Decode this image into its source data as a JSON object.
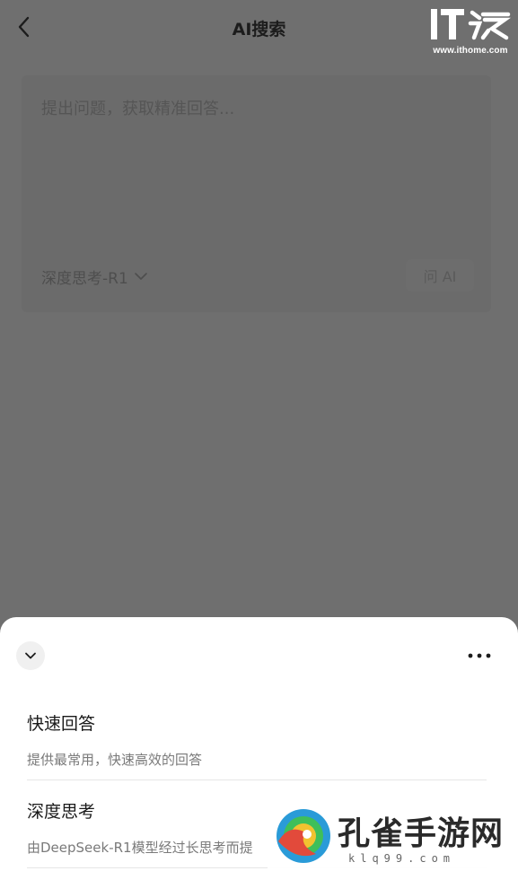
{
  "header": {
    "title": "AI搜索",
    "back_icon": "chevron-left-icon"
  },
  "logo": {
    "mark": "IT之家",
    "site": "www.ithome.com"
  },
  "search": {
    "placeholder": "提出问题，获取精准回答...",
    "model_label": "深度思考-R1",
    "ask_label": "问 AI"
  },
  "sheet": {
    "options": [
      {
        "title": "快速回答",
        "desc": "提供最常用，快速高效的回答"
      },
      {
        "title": "深度思考",
        "desc": "由DeepSeek-R1模型经过长思考而提"
      }
    ]
  },
  "watermark": {
    "text": "孔雀手游网",
    "url": "klq99.com"
  },
  "colors": {
    "overlay": "#6f6f6f",
    "sheet_bg": "#ffffff",
    "title_text": "#1c1c1c",
    "desc_text": "#7a7a7a"
  }
}
